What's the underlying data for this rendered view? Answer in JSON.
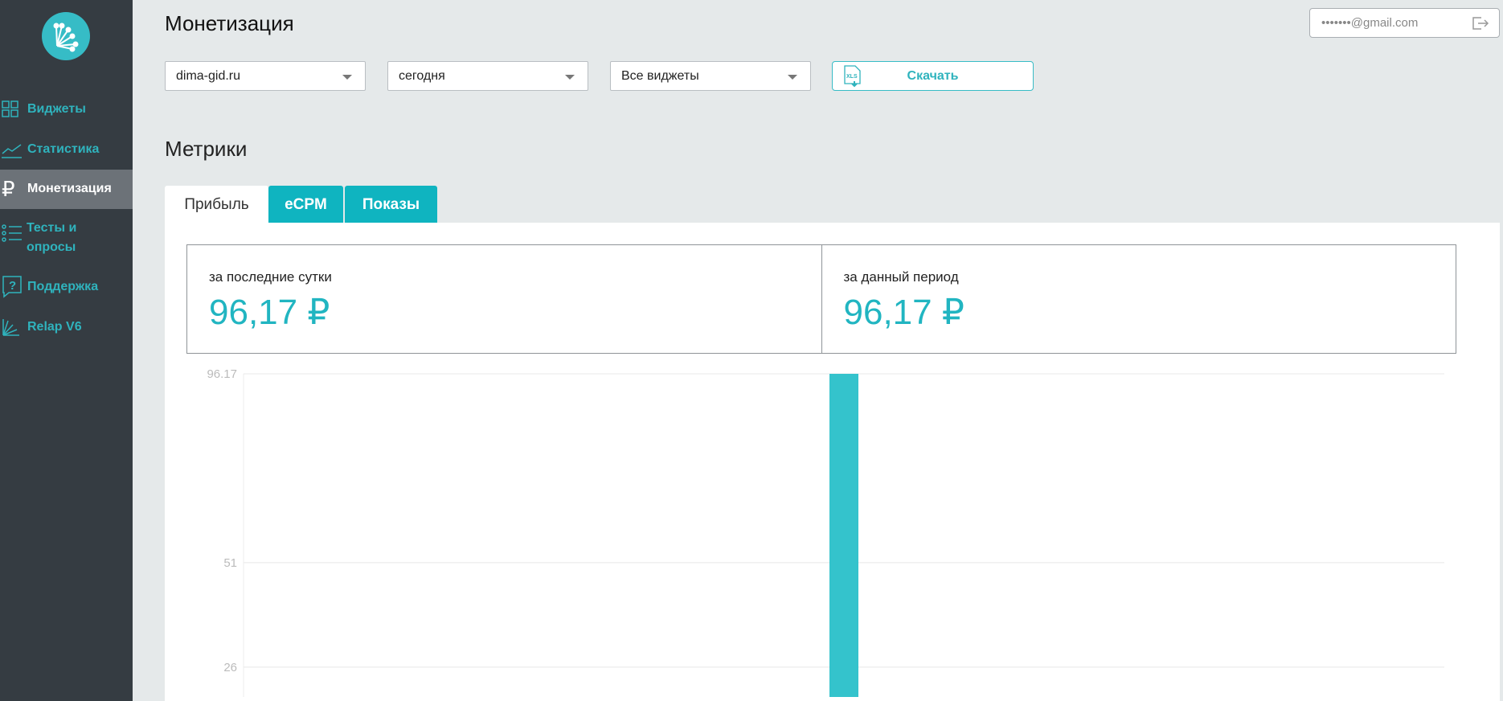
{
  "sidebar": {
    "items": [
      {
        "label": "Виджеты",
        "icon": "grid-icon"
      },
      {
        "label": "Статистика",
        "icon": "chart-line-icon"
      },
      {
        "label": "Монетизация",
        "icon": "ruble-icon",
        "active": true
      },
      {
        "label": "Тесты и опросы",
        "icon": "list-icon"
      },
      {
        "label": "Поддержка",
        "icon": "help-icon"
      },
      {
        "label": "Relap V6",
        "icon": "relap-icon"
      }
    ]
  },
  "header": {
    "title": "Монетизация",
    "user_email": "•••••••@gmail.com"
  },
  "filters": {
    "site": "dima-gid.ru",
    "period": "сегодня",
    "widgets": "Все виджеты",
    "download_label": "Скачать",
    "xls": "XLS"
  },
  "metrics": {
    "title": "Метрики",
    "tabs": [
      "Прибыль",
      "eCPM",
      "Показы"
    ],
    "last_day_label": "за последние сутки",
    "last_day_value": "96,17 ₽",
    "period_label": "за данный период",
    "period_value": "96,17 ₽"
  },
  "colors": {
    "accent": "#0fb4c0",
    "bar": "#34c3cc",
    "sidebar": "#353c42"
  },
  "chart_data": {
    "type": "bar",
    "values": [
      96.17
    ],
    "yticks": [
      "96.17",
      "51",
      "26"
    ],
    "ytick_values": [
      96.17,
      51,
      26
    ],
    "ylim": [
      0,
      96.17
    ],
    "grid": true
  }
}
